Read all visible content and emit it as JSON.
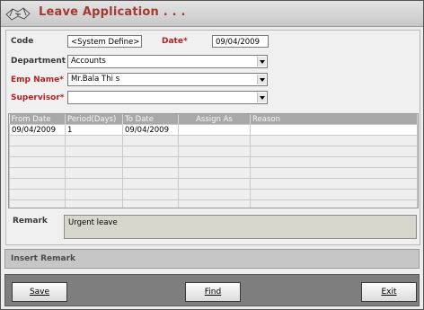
{
  "window": {
    "title": "Leave Application . . ."
  },
  "form": {
    "code_label": "Code",
    "code_value": "<System Define>",
    "date_label": "Date*",
    "date_value": "09/04/2009",
    "department_label": "Department",
    "department_value": "Accounts",
    "emp_name_label": "Emp Name*",
    "emp_name_value": "Mr.Bala Thi s",
    "supervisor_label": "Supervisor*",
    "supervisor_value": ""
  },
  "grid": {
    "columns": [
      "From Date",
      "Period(Days)",
      "To Date",
      "Assign As",
      "Reason"
    ],
    "rows": [
      [
        "09/04/2009",
        "1",
        "09/04/2009",
        "",
        ""
      ]
    ],
    "empty_rows": 7
  },
  "remark": {
    "label": "Remark",
    "value": "Urgent leave"
  },
  "insert_remark": {
    "label": "Insert Remark"
  },
  "buttons": {
    "save": "Save",
    "find": "Find",
    "exit": "Exit"
  },
  "colors": {
    "title": "#a33a32",
    "required_label": "#b22222",
    "grid_header": "#a8a8a8",
    "button_bar": "#7e7e7e"
  }
}
